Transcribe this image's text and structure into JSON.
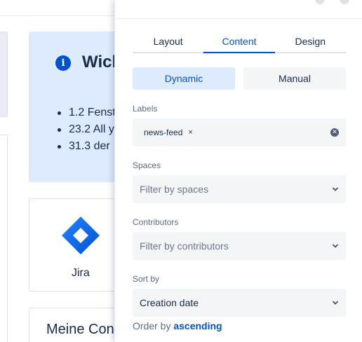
{
  "background": {
    "info_panel": {
      "heading": "Wich",
      "items": [
        "1.2 Fenst",
        "23.2 All y",
        "31.3 der "
      ]
    },
    "app_card": {
      "label": "Jira"
    },
    "content_card": {
      "heading": "Meine Con"
    }
  },
  "config_panel": {
    "tabs": [
      {
        "label": "Layout",
        "active": false
      },
      {
        "label": "Content",
        "active": true
      },
      {
        "label": "Design",
        "active": false
      }
    ],
    "mode_toggle": {
      "dynamic_label": "Dynamic",
      "manual_label": "Manual",
      "selected": "Dynamic"
    },
    "labels": {
      "label": "Labels",
      "tags": [
        "news-feed"
      ],
      "tag_remove_glyph": "×"
    },
    "spaces": {
      "label": "Spaces",
      "placeholder": "Filter by spaces"
    },
    "contributors": {
      "label": "Contributors",
      "placeholder": "Filter by contributors"
    },
    "sort_by": {
      "label": "Sort by",
      "value": "Creation date"
    },
    "order": {
      "prefix": "Order by",
      "value": "ascending"
    }
  },
  "colors": {
    "accent": "#0052cc",
    "accent_light": "#deebff",
    "field_bg": "#f4f5f7",
    "text": "#172b4d",
    "subtle_text": "#5e6c84"
  },
  "icons": {
    "info": "info-icon",
    "jira": "jira-logo",
    "chevron": "chevron-down-icon",
    "clear": "clear-icon"
  }
}
